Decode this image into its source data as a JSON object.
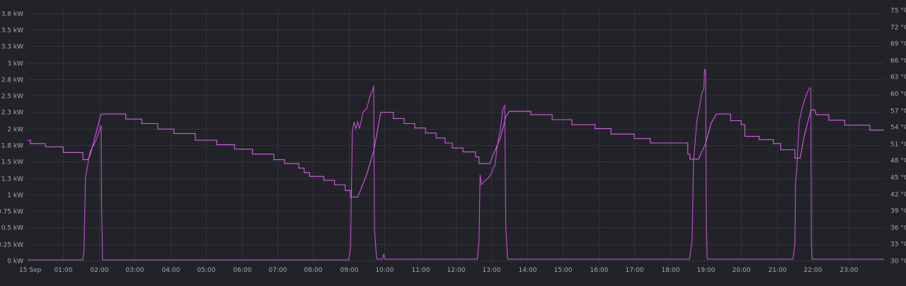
{
  "chart_data": {
    "type": "line",
    "x_start": "15 Sep",
    "x_ticks": [
      "15 Sep",
      "01:00",
      "02:00",
      "03:00",
      "04:00",
      "05:00",
      "06:00",
      "07:00",
      "08:00",
      "09:00",
      "10:00",
      "11:00",
      "12:00",
      "13:00",
      "14:00",
      "15:00",
      "16:00",
      "17:00",
      "18:00",
      "19:00",
      "20:00",
      "21:00",
      "22:00",
      "23:00"
    ],
    "xlim_hours": [
      0,
      24
    ],
    "left_axis": {
      "unit": "kW",
      "ylim": [
        0,
        3.8
      ],
      "ticks": [
        0,
        0.25,
        0.5,
        0.75,
        1,
        1.25,
        1.5,
        1.75,
        2,
        2.25,
        2.5,
        2.75,
        3,
        3.25,
        3.5,
        3.75
      ],
      "tick_labels": [
        "0 kW",
        "0.25 kW",
        "0.5 kW",
        "0.75 kW",
        "1 kW",
        "1.3 kW",
        "1.5 kW",
        "1.8 kW",
        "2 kW",
        "2.3 kW",
        "2.5 kW",
        "2.8 kW",
        "3 kW",
        "3.3 kW",
        "3.5 kW",
        "3.8 kW"
      ]
    },
    "right_axis": {
      "unit": "°C",
      "ylim": [
        30,
        75
      ],
      "ticks": [
        30,
        33,
        36,
        39,
        42,
        45,
        48,
        51,
        54,
        57,
        60,
        63,
        66,
        69,
        72,
        75
      ],
      "tick_labels": [
        "30 °C",
        "33 °C",
        "36 °C",
        "39 °C",
        "42 °C",
        "45 °C",
        "48 °C",
        "51 °C",
        "54 °C",
        "57 °C",
        "60 °C",
        "63 °C",
        "66 °C",
        "69 °C",
        "72 °C",
        "75 °C"
      ]
    },
    "grid": true,
    "series": [
      {
        "axis": "left",
        "color": "#c24fd3",
        "points": [
          [
            0,
            0.01
          ],
          [
            1.55,
            0.01
          ],
          [
            1.58,
            0.15
          ],
          [
            1.62,
            1.25
          ],
          [
            1.7,
            1.5
          ],
          [
            1.75,
            1.65
          ],
          [
            1.8,
            1.7
          ],
          [
            1.9,
            1.8
          ],
          [
            2.0,
            1.95
          ],
          [
            2.06,
            2.05
          ],
          [
            2.07,
            0.9
          ],
          [
            2.1,
            0.01
          ],
          [
            9.0,
            0.01
          ],
          [
            9.05,
            0.2
          ],
          [
            9.1,
            1.95
          ],
          [
            9.15,
            2.1
          ],
          [
            9.2,
            2.0
          ],
          [
            9.25,
            2.1
          ],
          [
            9.3,
            2.0
          ],
          [
            9.4,
            2.25
          ],
          [
            9.5,
            2.3
          ],
          [
            9.6,
            2.5
          ],
          [
            9.68,
            2.6
          ],
          [
            9.7,
            2.65
          ],
          [
            9.72,
            0.5
          ],
          [
            9.78,
            0.02
          ],
          [
            9.95,
            0.02
          ],
          [
            9.98,
            0.1
          ],
          [
            10.02,
            0.02
          ],
          [
            12.6,
            0.02
          ],
          [
            12.65,
            0.3
          ],
          [
            12.68,
            1.3
          ],
          [
            12.72,
            1.15
          ],
          [
            12.8,
            1.2
          ],
          [
            12.9,
            1.25
          ],
          [
            13.0,
            1.32
          ],
          [
            13.05,
            1.4
          ],
          [
            13.1,
            1.45
          ],
          [
            13.15,
            1.7
          ],
          [
            13.25,
            2.0
          ],
          [
            13.32,
            2.3
          ],
          [
            13.37,
            2.35
          ],
          [
            13.4,
            0.5
          ],
          [
            13.45,
            0.02
          ],
          [
            18.55,
            0.02
          ],
          [
            18.62,
            0.3
          ],
          [
            18.66,
            1.5
          ],
          [
            18.7,
            1.75
          ],
          [
            18.75,
            2.1
          ],
          [
            18.8,
            2.25
          ],
          [
            18.85,
            2.4
          ],
          [
            18.9,
            2.55
          ],
          [
            18.95,
            2.6
          ],
          [
            18.97,
            2.9
          ],
          [
            19.0,
            2.88
          ],
          [
            19.02,
            0.5
          ],
          [
            19.05,
            0.02
          ],
          [
            21.45,
            0.02
          ],
          [
            21.5,
            0.25
          ],
          [
            21.52,
            1.2
          ],
          [
            21.55,
            1.35
          ],
          [
            21.62,
            2.1
          ],
          [
            21.7,
            2.3
          ],
          [
            21.78,
            2.45
          ],
          [
            21.85,
            2.55
          ],
          [
            21.92,
            2.62
          ],
          [
            21.95,
            2.6
          ],
          [
            21.96,
            0.3
          ],
          [
            21.98,
            0.02
          ],
          [
            24,
            0.02
          ]
        ]
      },
      {
        "axis": "right",
        "color": "#d35ce6",
        "points": [
          [
            0,
            51.6
          ],
          [
            0.08,
            51.6
          ],
          [
            0.08,
            51.0
          ],
          [
            0.5,
            51.0
          ],
          [
            0.5,
            50.4
          ],
          [
            1.0,
            50.4
          ],
          [
            1.0,
            49.4
          ],
          [
            1.55,
            49.4
          ],
          [
            1.55,
            48.1
          ],
          [
            1.68,
            48.1
          ],
          [
            1.75,
            48.8
          ],
          [
            2.0,
            54.8
          ],
          [
            2.05,
            56.2
          ],
          [
            2.1,
            56.3
          ],
          [
            2.75,
            56.3
          ],
          [
            2.75,
            55.4
          ],
          [
            3.2,
            55.4
          ],
          [
            3.2,
            54.6
          ],
          [
            3.65,
            54.6
          ],
          [
            3.65,
            53.6
          ],
          [
            4.1,
            53.6
          ],
          [
            4.1,
            52.8
          ],
          [
            4.7,
            52.8
          ],
          [
            4.7,
            51.6
          ],
          [
            5.3,
            51.6
          ],
          [
            5.3,
            50.8
          ],
          [
            5.8,
            50.8
          ],
          [
            5.8,
            50.0
          ],
          [
            6.3,
            50.0
          ],
          [
            6.3,
            49.1
          ],
          [
            6.9,
            49.1
          ],
          [
            6.9,
            48.1
          ],
          [
            7.2,
            48.1
          ],
          [
            7.2,
            47.4
          ],
          [
            7.6,
            47.4
          ],
          [
            7.6,
            46.6
          ],
          [
            7.75,
            46.6
          ],
          [
            7.75,
            45.8
          ],
          [
            7.9,
            45.8
          ],
          [
            7.9,
            45.1
          ],
          [
            8.3,
            45.1
          ],
          [
            8.3,
            44.4
          ],
          [
            8.6,
            44.4
          ],
          [
            8.6,
            43.6
          ],
          [
            8.9,
            43.6
          ],
          [
            8.9,
            42.6
          ],
          [
            9.05,
            42.6
          ],
          [
            9.05,
            41.4
          ],
          [
            9.25,
            41.4
          ],
          [
            9.5,
            45.4
          ],
          [
            9.7,
            49.7
          ],
          [
            9.85,
            55.0
          ],
          [
            9.9,
            56.6
          ],
          [
            10.25,
            56.6
          ],
          [
            10.25,
            55.5
          ],
          [
            10.55,
            55.5
          ],
          [
            10.55,
            54.6
          ],
          [
            10.85,
            54.6
          ],
          [
            10.85,
            53.8
          ],
          [
            11.15,
            53.8
          ],
          [
            11.15,
            52.9
          ],
          [
            11.45,
            52.9
          ],
          [
            11.45,
            52.0
          ],
          [
            11.7,
            52.0
          ],
          [
            11.7,
            51.1
          ],
          [
            11.9,
            51.1
          ],
          [
            11.9,
            50.2
          ],
          [
            12.2,
            50.2
          ],
          [
            12.2,
            49.5
          ],
          [
            12.55,
            49.5
          ],
          [
            12.55,
            48.6
          ],
          [
            12.65,
            48.6
          ],
          [
            12.65,
            47.4
          ],
          [
            12.95,
            47.4
          ],
          [
            13.05,
            49.0
          ],
          [
            13.25,
            52.0
          ],
          [
            13.4,
            55.8
          ],
          [
            13.5,
            56.8
          ],
          [
            14.1,
            56.8
          ],
          [
            14.1,
            56.2
          ],
          [
            14.7,
            56.2
          ],
          [
            14.7,
            55.3
          ],
          [
            15.25,
            55.3
          ],
          [
            15.25,
            54.4
          ],
          [
            15.9,
            54.4
          ],
          [
            15.9,
            53.7
          ],
          [
            16.35,
            53.7
          ],
          [
            16.35,
            52.7
          ],
          [
            17.0,
            52.7
          ],
          [
            17.0,
            51.9
          ],
          [
            17.45,
            51.9
          ],
          [
            17.45,
            51.1
          ],
          [
            18.5,
            51.1
          ],
          [
            18.5,
            49.1
          ],
          [
            18.56,
            49.1
          ],
          [
            18.56,
            48.2
          ],
          [
            18.8,
            48.2
          ],
          [
            19.0,
            51.0
          ],
          [
            19.15,
            54.6
          ],
          [
            19.3,
            56.3
          ],
          [
            19.7,
            56.3
          ],
          [
            19.7,
            55.1
          ],
          [
            20.0,
            55.1
          ],
          [
            20.0,
            54.4
          ],
          [
            20.1,
            54.4
          ],
          [
            20.1,
            52.3
          ],
          [
            20.5,
            52.3
          ],
          [
            20.5,
            51.7
          ],
          [
            20.9,
            51.7
          ],
          [
            20.9,
            51.0
          ],
          [
            21.1,
            51.0
          ],
          [
            21.1,
            49.9
          ],
          [
            21.5,
            49.9
          ],
          [
            21.5,
            48.4
          ],
          [
            21.65,
            48.4
          ],
          [
            21.75,
            52.0
          ],
          [
            21.95,
            57.0
          ],
          [
            22.05,
            57.1
          ],
          [
            22.1,
            56.2
          ],
          [
            22.45,
            56.2
          ],
          [
            22.45,
            55.2
          ],
          [
            22.9,
            55.2
          ],
          [
            22.9,
            54.3
          ],
          [
            23.6,
            54.3
          ],
          [
            23.6,
            53.4
          ],
          [
            24.0,
            53.4
          ]
        ]
      }
    ]
  }
}
